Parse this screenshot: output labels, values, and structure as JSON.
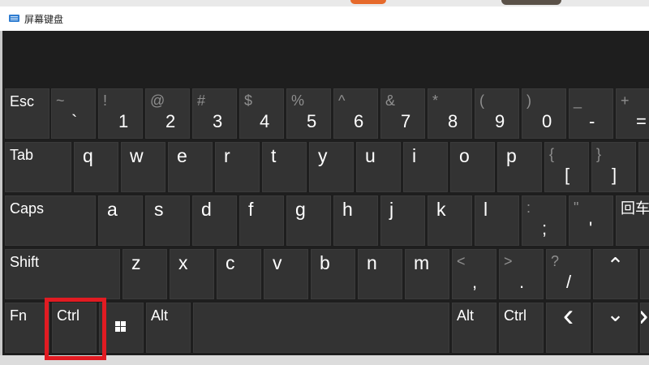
{
  "window": {
    "title": "屏幕键盘"
  },
  "rows": {
    "row1": [
      {
        "label": "Esc"
      },
      {
        "sym": "~",
        "main": "`"
      },
      {
        "sym": "!",
        "main": "1"
      },
      {
        "sym": "@",
        "main": "2"
      },
      {
        "sym": "#",
        "main": "3"
      },
      {
        "sym": "$",
        "main": "4"
      },
      {
        "sym": "%",
        "main": "5"
      },
      {
        "sym": "^",
        "main": "6"
      },
      {
        "sym": "&",
        "main": "7"
      },
      {
        "sym": "*",
        "main": "8"
      },
      {
        "sym": "(",
        "main": "9"
      },
      {
        "sym": ")",
        "main": "0"
      },
      {
        "sym": "_",
        "main": "-"
      },
      {
        "sym": "+",
        "main": "="
      }
    ],
    "row2": [
      {
        "label": "Tab"
      },
      {
        "letter": "q"
      },
      {
        "letter": "w"
      },
      {
        "letter": "e"
      },
      {
        "letter": "r"
      },
      {
        "letter": "t"
      },
      {
        "letter": "y"
      },
      {
        "letter": "u"
      },
      {
        "letter": "i"
      },
      {
        "letter": "o"
      },
      {
        "letter": "p"
      },
      {
        "sym": "{",
        "main": "["
      },
      {
        "sym": "}",
        "main": "]"
      }
    ],
    "row3": [
      {
        "label": "Caps"
      },
      {
        "letter": "a"
      },
      {
        "letter": "s"
      },
      {
        "letter": "d"
      },
      {
        "letter": "f"
      },
      {
        "letter": "g"
      },
      {
        "letter": "h"
      },
      {
        "letter": "j"
      },
      {
        "letter": "k"
      },
      {
        "letter": "l"
      },
      {
        "sym": ":",
        "main": ";"
      },
      {
        "sym": "\"",
        "main": "'"
      },
      {
        "label": "回车"
      }
    ],
    "row4": [
      {
        "label": "Shift"
      },
      {
        "letter": "z"
      },
      {
        "letter": "x"
      },
      {
        "letter": "c"
      },
      {
        "letter": "v"
      },
      {
        "letter": "b"
      },
      {
        "letter": "n"
      },
      {
        "letter": "m"
      },
      {
        "sym": "<",
        "main": ","
      },
      {
        "sym": ">",
        "main": "."
      },
      {
        "sym": "?",
        "main": "/"
      },
      {
        "arrow": "⌃"
      }
    ],
    "row5": [
      {
        "label": "Fn"
      },
      {
        "label": "Ctrl"
      },
      {
        "icon": "windows-icon"
      },
      {
        "label": "Alt"
      },
      {
        "label": ""
      },
      {
        "label": "Alt"
      },
      {
        "label": "Ctrl"
      },
      {
        "arrow": "‹"
      },
      {
        "arrow": "⌄"
      },
      {
        "arrow": "›"
      }
    ]
  },
  "highlight": {
    "color": "#e11b22",
    "target": "Ctrl"
  },
  "colors": {
    "key": "#333333",
    "panel": "#1e1e1e",
    "text": "#ffffff",
    "shift_symbol": "#8f8f8f"
  }
}
